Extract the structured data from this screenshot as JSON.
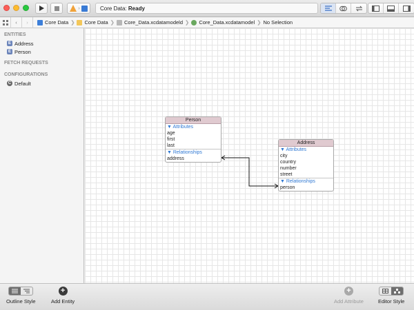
{
  "window": {
    "activity": {
      "prefix": "Core Data: ",
      "status": "Ready"
    }
  },
  "jumpbar": {
    "crumbs": [
      "Core Data",
      "Core Data",
      "Core_Data.xcdatamodeld",
      "Core_Data.xcdatamodel",
      "No Selection"
    ]
  },
  "sidebar": {
    "entities_header": "ENTITIES",
    "entities": [
      {
        "badge": "E",
        "label": "Address"
      },
      {
        "badge": "E",
        "label": "Person"
      }
    ],
    "fetch_header": "FETCH REQUESTS",
    "configs_header": "CONFIGURATIONS",
    "configurations": [
      {
        "badge": "C",
        "label": "Default"
      }
    ]
  },
  "diagram": {
    "person": {
      "title": "Person",
      "attributes_label": "▼ Attributes",
      "attributes": [
        "age",
        "first",
        "last"
      ],
      "relationships_label": "▼ Relationships",
      "relationships": [
        "address"
      ]
    },
    "address": {
      "title": "Address",
      "attributes_label": "▼ Attributes",
      "attributes": [
        "city",
        "country",
        "number",
        "street"
      ],
      "relationships_label": "▼ Relationships",
      "relationships": [
        "person"
      ]
    }
  },
  "bottom": {
    "outline_style": "Outline Style",
    "add_entity": "Add Entity",
    "add_attribute": "Add Attribute",
    "editor_style": "Editor Style"
  },
  "colors": {
    "accent": "#2f78d3",
    "entity_header": "#e0cad0",
    "badge": "#6b84ba"
  }
}
